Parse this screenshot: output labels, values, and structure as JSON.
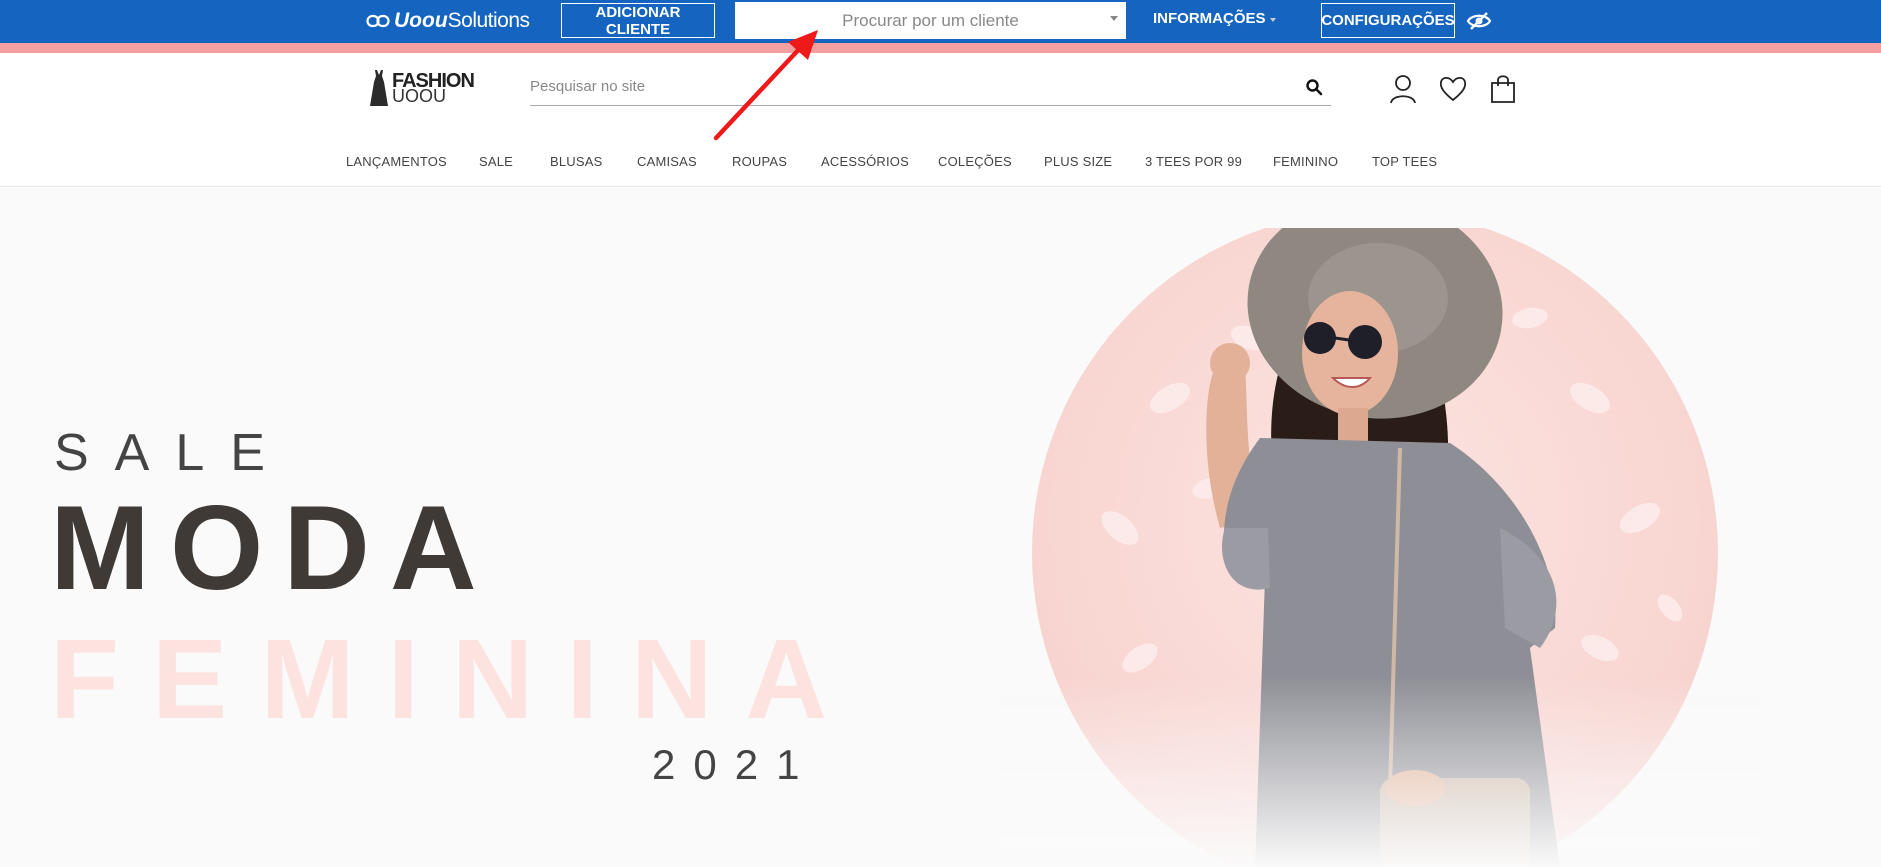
{
  "admin_bar": {
    "brand_bold": "Uoou",
    "brand_light": "Solutions",
    "add_client_label": "ADICIONAR CLIENTE",
    "client_search_placeholder": "Procurar por um cliente",
    "info_menu_label": "INFORMAÇÕES",
    "settings_label": "CONFIGURAÇÕES",
    "colors": {
      "bar": "#1565c0",
      "stripe": "#f4a0a0"
    }
  },
  "header": {
    "logo_top": "FASHION",
    "logo_bottom": "UOOU",
    "search_placeholder": "Pesquisar no site",
    "icons": [
      "search-icon",
      "user-icon",
      "heart-icon",
      "bag-icon"
    ]
  },
  "nav": {
    "items": [
      "LANÇAMENTOS",
      "SALE",
      "BLUSAS",
      "CAMISAS",
      "ROUPAS",
      "ACESSÓRIOS",
      "COLEÇÕES",
      "PLUS SIZE",
      "3 TEES POR 99",
      "FEMININO",
      "TOP TEES"
    ]
  },
  "hero": {
    "line1": "SALE",
    "line2": "MODA",
    "line3": "FEMININA",
    "year": "2021",
    "colors": {
      "dark_text": "#3f3a36",
      "pink_text": "#fde3df",
      "circle": "#fdd9d6"
    }
  }
}
